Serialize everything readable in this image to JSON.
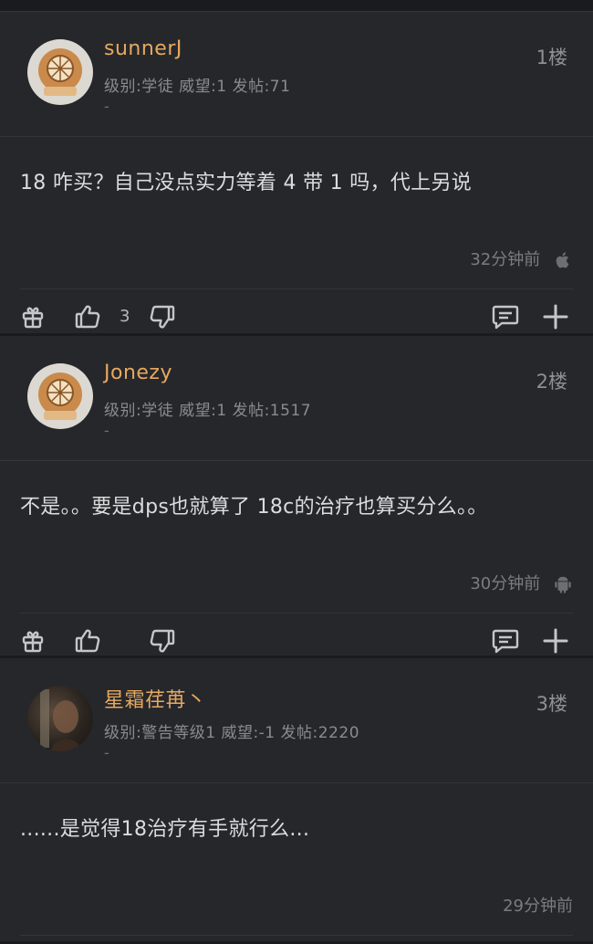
{
  "posts": [
    {
      "username": "sunnerJ",
      "meta": "级别:学徒 威望:1 发帖:71",
      "dash": "-",
      "floor": "1楼",
      "content": "18 咋买？自己没点实力等着 4 带 1 吗，代上另说",
      "time": "32分钟前",
      "platform_icon": "apple-icon",
      "like_count": "3"
    },
    {
      "username": "Jonezy",
      "meta": "级别:学徒 威望:1 发帖:1517",
      "dash": "-",
      "floor": "2楼",
      "content": "不是。。要是dps也就算了 18c的治疗也算买分么。。",
      "time": "30分钟前",
      "platform_icon": "android-icon",
      "like_count": ""
    },
    {
      "username": "星霜荏苒丶",
      "meta": "级别:警告等级1 威望:-1 发帖:2220",
      "dash": "-",
      "floor": "3楼",
      "content": "......是觉得18治疗有手就行么...",
      "time": "29分钟前",
      "platform_icon": "",
      "like_count": ""
    }
  ],
  "colors": {
    "background": "#26272b",
    "username": "#e5a960",
    "meta": "#8a8b8f",
    "text": "#dcdcdc"
  }
}
